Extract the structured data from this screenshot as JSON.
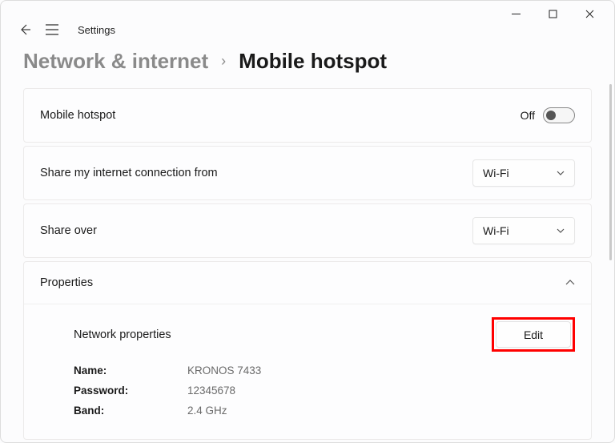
{
  "app_title": "Settings",
  "window_controls": {
    "minimize": "—",
    "maximize": "☐",
    "close": "✕"
  },
  "breadcrumb": {
    "parent": "Network & internet",
    "separator": "›",
    "current": "Mobile hotspot"
  },
  "rows": {
    "hotspot": {
      "label": "Mobile hotspot",
      "state": "Off"
    },
    "share_from": {
      "label": "Share my internet connection from",
      "value": "Wi-Fi"
    },
    "share_over": {
      "label": "Share over",
      "value": "Wi-Fi"
    }
  },
  "properties": {
    "header": "Properties",
    "network_props_label": "Network properties",
    "edit_label": "Edit",
    "items": {
      "name": {
        "key": "Name:",
        "val": "KRONOS 7433"
      },
      "password": {
        "key": "Password:",
        "val": "12345678"
      },
      "band": {
        "key": "Band:",
        "val": "2.4 GHz"
      }
    }
  }
}
